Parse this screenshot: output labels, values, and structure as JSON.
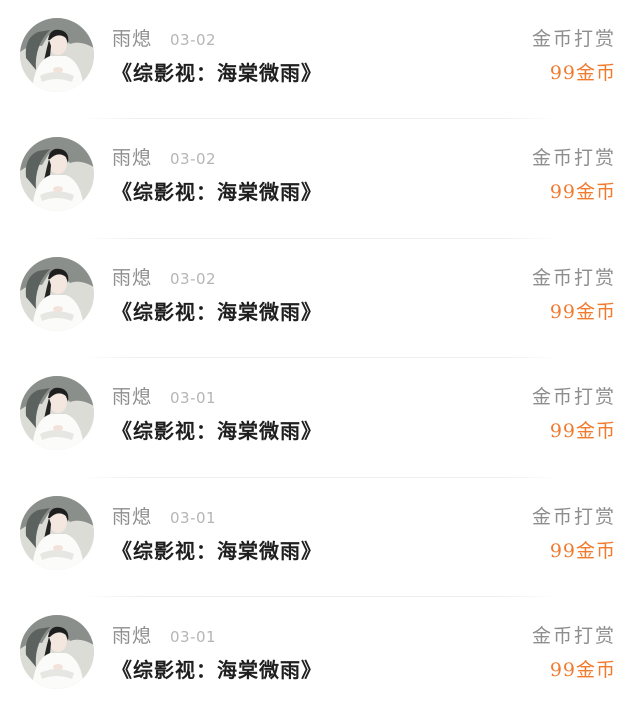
{
  "records": [
    {
      "user": "雨熄",
      "date": "03-02",
      "book": "《综影视：海棠微雨》",
      "action": "金币打赏",
      "amount": "99金币"
    },
    {
      "user": "雨熄",
      "date": "03-02",
      "book": "《综影视：海棠微雨》",
      "action": "金币打赏",
      "amount": "99金币"
    },
    {
      "user": "雨熄",
      "date": "03-02",
      "book": "《综影视：海棠微雨》",
      "action": "金币打赏",
      "amount": "99金币"
    },
    {
      "user": "雨熄",
      "date": "03-01",
      "book": "《综影视：海棠微雨》",
      "action": "金币打赏",
      "amount": "99金币"
    },
    {
      "user": "雨熄",
      "date": "03-01",
      "book": "《综影视：海棠微雨》",
      "action": "金币打赏",
      "amount": "99金币"
    },
    {
      "user": "雨熄",
      "date": "03-01",
      "book": "《综影视：海棠微雨》",
      "action": "金币打赏",
      "amount": "99金币"
    }
  ],
  "colors": {
    "amount": "#f07b2e",
    "muted": "#8e8e8e",
    "title": "#1f1f1f"
  },
  "icons": {
    "avatar": "user-avatar-portrait"
  }
}
